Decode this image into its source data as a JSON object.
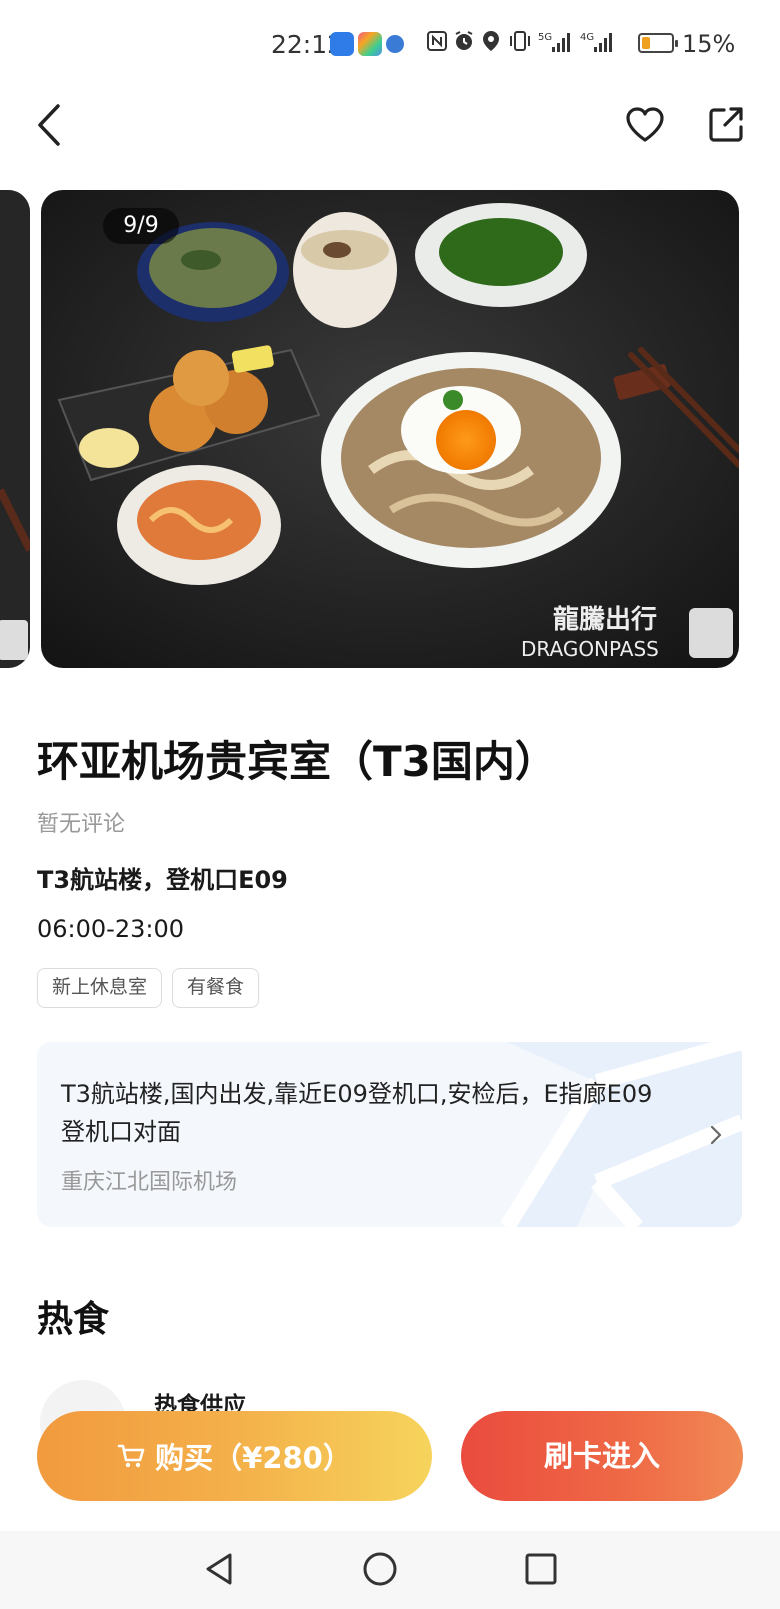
{
  "status_bar": {
    "time": "22:12",
    "battery_text": "15%",
    "battery_level": 0.15,
    "signal_label_1": "5G",
    "signal_label_2": "4G",
    "icons": [
      "nfc-icon",
      "alarm-icon",
      "location-icon",
      "vibrate-icon",
      "signal-5g-icon",
      "signal-4g-icon",
      "battery-icon"
    ]
  },
  "nav": {
    "icons": [
      "back-arrow-icon",
      "heart-icon",
      "share-icon"
    ]
  },
  "gallery": {
    "counter": "9/9",
    "watermark_cn": "龍騰出行",
    "watermark_en": "DRAGONPASS"
  },
  "lounge": {
    "title": "环亚机场贵宾室（T3国内）",
    "reviews": "暂无评论",
    "location": "T3航站楼，登机口E09",
    "hours": "06:00-23:00",
    "tags": [
      "新上休息室",
      "有餐食"
    ]
  },
  "address": {
    "description": "T3航站楼,国内出发,靠近E09登机口,安检后，E指廊E09登机口对面",
    "airport": "重庆江北国际机场"
  },
  "section": {
    "title": "热食",
    "item_name": "热食供应"
  },
  "actions": {
    "buy_label": "购买（¥280）",
    "card_label": "刷卡进入"
  },
  "colors": {
    "buy_gradient_start": "#f19a3e",
    "buy_gradient_end": "#f6d45c",
    "card_gradient_start": "#ea4b3e",
    "card_gradient_end": "#f08a55",
    "address_card_bg": "#f4f8fd"
  }
}
